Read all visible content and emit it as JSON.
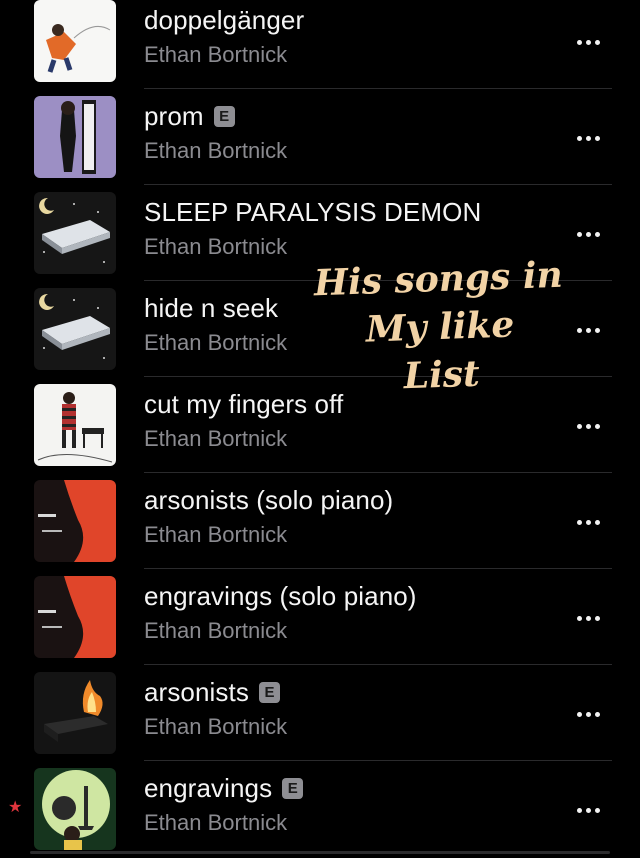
{
  "songs": [
    {
      "title": "doppelgänger",
      "artist": "Ethan Bortnick",
      "explicit": false
    },
    {
      "title": "prom",
      "artist": "Ethan Bortnick",
      "explicit": true
    },
    {
      "title": "SLEEP PARALYSIS DEMON",
      "artist": "Ethan Bortnick",
      "explicit": false
    },
    {
      "title": "hide n seek",
      "artist": "Ethan Bortnick",
      "explicit": false
    },
    {
      "title": "cut my fingers off",
      "artist": "Ethan Bortnick",
      "explicit": false
    },
    {
      "title": "arsonists (solo piano)",
      "artist": "Ethan Bortnick",
      "explicit": false
    },
    {
      "title": "engravings (solo piano)",
      "artist": "Ethan Bortnick",
      "explicit": false
    },
    {
      "title": "arsonists",
      "artist": "Ethan Bortnick",
      "explicit": true
    },
    {
      "title": "engravings",
      "artist": "Ethan Bortnick",
      "explicit": true
    }
  ],
  "explicit_badge": "E",
  "handwritten_note": [
    "His songs in",
    "My like",
    "List"
  ],
  "icons": {
    "more": "ellipsis-icon",
    "star": "star-icon"
  },
  "colors": {
    "background": "#000000",
    "title": "#f5f5f5",
    "artist": "#8b8b90",
    "note": "#f2d3a6",
    "star": "#e0353d"
  }
}
